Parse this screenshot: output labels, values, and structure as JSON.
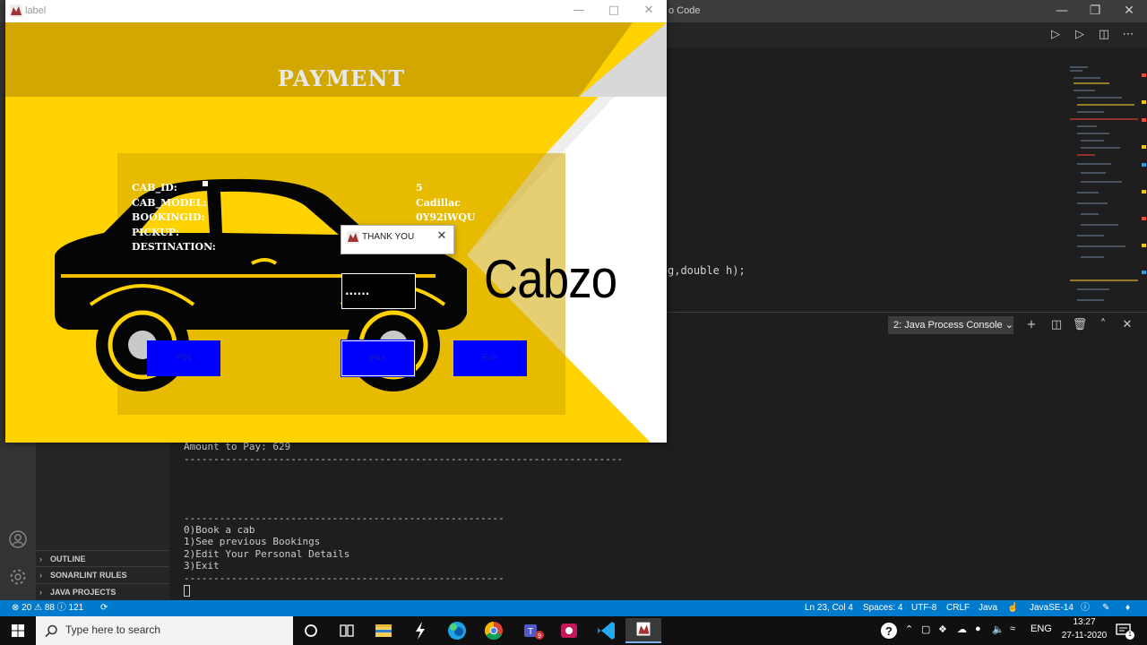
{
  "vscode": {
    "title_fragment": "o Code",
    "code_line": "g,double h);",
    "side_sections": [
      "OUTLINE",
      "SONARLINT RULES",
      "JAVA PROJECTS"
    ],
    "panel_terminal_select": "2: Java Process Console",
    "terminal": {
      "amount": "Amount to Pay: 629",
      "separator_long": "--------------------------------------------------------------------------",
      "separator_short": "------------------------------------------------------",
      "menu": [
        "0)Book a cab",
        "1)See previous Bookings",
        "2)Edit Your Personal Details",
        "3)Exit"
      ]
    },
    "statusbar": {
      "errors": "20",
      "warnings": "88",
      "info": "121",
      "cursor": "Ln 23, Col 4",
      "spaces": "Spaces: 4",
      "encoding": "UTF-8",
      "eol": "CRLF",
      "language": "Java",
      "runtime": "JavaSE-14"
    }
  },
  "java_window": {
    "title": "label",
    "heading": "PAYMENT",
    "labels": [
      "CAB_ID:",
      "CAB_MODEL:",
      "BOOKINGID:",
      "PICKUP:",
      "DESTINATION:"
    ],
    "values": [
      "5",
      "Cadillac",
      "0Y92iWQU"
    ],
    "brand": "Cabzo",
    "pin_value": "......",
    "buttons": {
      "pin": "PIN",
      "pay": "PAY",
      "exit": "Exit"
    }
  },
  "dialog": {
    "title": "THANK YOU"
  },
  "taskbar": {
    "search_placeholder": "Type here to search",
    "language": "ENG",
    "time": "13:27",
    "date": "27-11-2020",
    "notification_count": "1"
  },
  "colors": {
    "accent_yellow": "#ffd200",
    "header_gold": "#d2a800",
    "button_blue": "#0000ff",
    "statusbar_blue": "#007acc"
  }
}
